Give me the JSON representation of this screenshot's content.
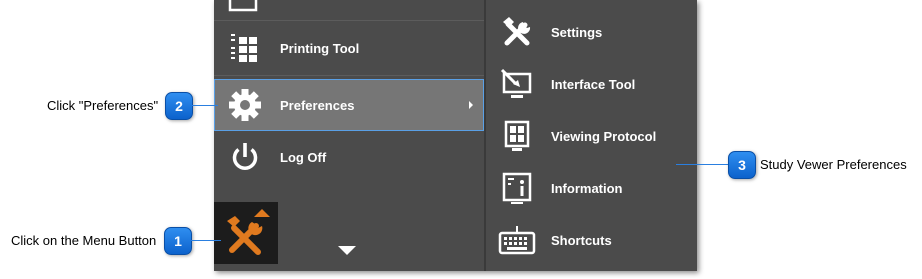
{
  "menu": {
    "left_items": [
      {
        "label": "Printing Tool",
        "icon": "printing-tool-icon"
      },
      {
        "label": "Preferences",
        "icon": "gear-icon",
        "selected": true,
        "has_submenu": true
      },
      {
        "label": "Log Off",
        "icon": "power-icon"
      }
    ],
    "right_items": [
      {
        "label": "Settings",
        "icon": "wrench-screwdriver-icon"
      },
      {
        "label": "Interface Tool",
        "icon": "interface-tool-icon"
      },
      {
        "label": "Viewing Protocol",
        "icon": "viewing-protocol-icon"
      },
      {
        "label": "Information",
        "icon": "information-icon"
      },
      {
        "label": "Shortcuts",
        "icon": "keyboard-icon"
      }
    ],
    "menu_button_icon": "tools-icon",
    "more_icon": "chevron-down-icon"
  },
  "callouts": [
    {
      "number": "1",
      "text": "Click on the Menu Button"
    },
    {
      "number": "2",
      "text": "Click \"Preferences\""
    },
    {
      "number": "3",
      "text": "Study Vewer Preferences"
    }
  ],
  "colors": {
    "menu_bg": "#4b4b4b",
    "selected_bg": "#767676",
    "accent_orange": "#e07a1f",
    "callout_blue": "#1a73e0"
  }
}
